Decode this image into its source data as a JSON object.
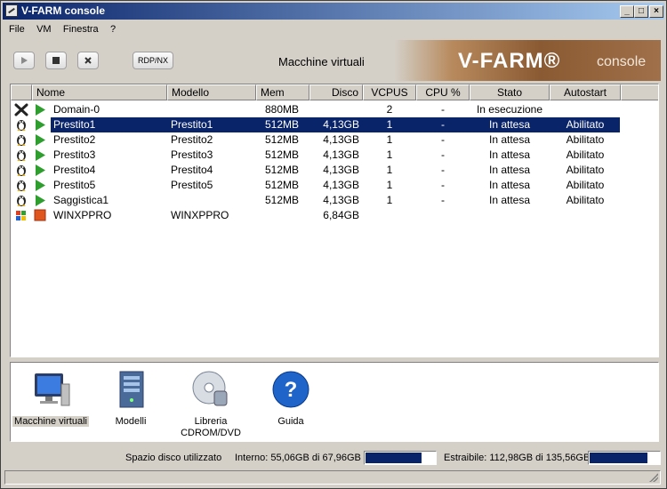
{
  "window": {
    "title": "V-FARM console",
    "controls": {
      "minimize": "_",
      "maximize": "□",
      "close": "×"
    }
  },
  "menu": [
    "File",
    "VM",
    "Finestra",
    "?"
  ],
  "toolbar": {
    "play_icon": "play-icon",
    "stop_icon": "stop-icon",
    "close_icon": "close-icon",
    "rdp_label": "RDP/NX",
    "section_title": "Macchine virtuali",
    "logo_brand": "V-FARM®",
    "logo_sub": "console"
  },
  "table": {
    "columns": [
      "Nome",
      "Modello",
      "Mem",
      "Disco",
      "VCPUS",
      "CPU %",
      "Stato",
      "Autostart"
    ],
    "rows": [
      {
        "os_icon": "xen-icon",
        "status_icon": "running-icon",
        "nome": "Domain-0",
        "modello": "",
        "mem": "880MB",
        "disco": "",
        "vcpus": "2",
        "cpu": "-",
        "stato": "In esecuzione",
        "autostart": "",
        "selected": false
      },
      {
        "os_icon": "linux-icon",
        "status_icon": "running-icon",
        "nome": "Prestito1",
        "modello": "Prestito1",
        "mem": "512MB",
        "disco": "4,13GB",
        "vcpus": "1",
        "cpu": "-",
        "stato": "In attesa",
        "autostart": "Abilitato",
        "selected": true
      },
      {
        "os_icon": "linux-icon",
        "status_icon": "running-icon",
        "nome": "Prestito2",
        "modello": "Prestito2",
        "mem": "512MB",
        "disco": "4,13GB",
        "vcpus": "1",
        "cpu": "-",
        "stato": "In attesa",
        "autostart": "Abilitato",
        "selected": false
      },
      {
        "os_icon": "linux-icon",
        "status_icon": "running-icon",
        "nome": "Prestito3",
        "modello": "Prestito3",
        "mem": "512MB",
        "disco": "4,13GB",
        "vcpus": "1",
        "cpu": "-",
        "stato": "In attesa",
        "autostart": "Abilitato",
        "selected": false
      },
      {
        "os_icon": "linux-icon",
        "status_icon": "running-icon",
        "nome": "Prestito4",
        "modello": "Prestito4",
        "mem": "512MB",
        "disco": "4,13GB",
        "vcpus": "1",
        "cpu": "-",
        "stato": "In attesa",
        "autostart": "Abilitato",
        "selected": false
      },
      {
        "os_icon": "linux-icon",
        "status_icon": "running-icon",
        "nome": "Prestito5",
        "modello": "Prestito5",
        "mem": "512MB",
        "disco": "4,13GB",
        "vcpus": "1",
        "cpu": "-",
        "stato": "In attesa",
        "autostart": "Abilitato",
        "selected": false
      },
      {
        "os_icon": "linux-icon",
        "status_icon": "running-icon",
        "nome": "Saggistica1",
        "modello": "",
        "mem": "512MB",
        "disco": "4,13GB",
        "vcpus": "1",
        "cpu": "-",
        "stato": "In attesa",
        "autostart": "Abilitato",
        "selected": false
      },
      {
        "os_icon": "windows-icon",
        "status_icon": "stopped-icon",
        "nome": "WINXPPRO",
        "modello": "WINXPPRO",
        "mem": "",
        "disco": "6,84GB",
        "vcpus": "",
        "cpu": "",
        "stato": "",
        "autostart": "",
        "selected": false
      }
    ]
  },
  "nav": [
    {
      "icon": "monitor-icon",
      "label": "Macchine virtuali",
      "active": true
    },
    {
      "icon": "server-icon",
      "label": "Modelli",
      "active": false
    },
    {
      "icon": "cdrom-icon",
      "label": "Libreria CDROM/DVD",
      "active": false
    },
    {
      "icon": "help-icon",
      "label": "Guida",
      "active": false
    }
  ],
  "status": {
    "label": "Spazio disco utilizzato",
    "internal_text": "Interno: 55,06GB di 67,96GB",
    "internal_fraction": 0.81,
    "removable_text": "Estraibile: 112,98GB di 135,56GB",
    "removable_fraction": 0.833
  },
  "colors": {
    "selection": "#0a246a",
    "running": "#2e9e2e",
    "stopped": "#e0561f"
  }
}
